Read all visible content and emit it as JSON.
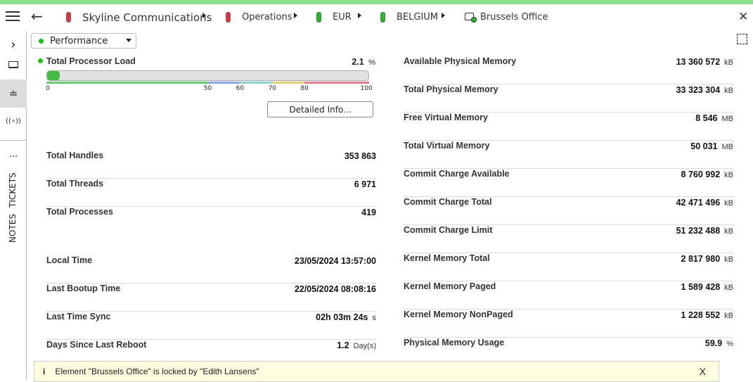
{
  "breadcrumb": [
    {
      "label": "Skyline Communications",
      "status_color": "#e0323c"
    },
    {
      "label": "Operations",
      "status_color": "#e0323c"
    },
    {
      "label": "EUR",
      "status_color": "#22bb22"
    },
    {
      "label": "BELGIUM",
      "status_color": "#22bb22"
    },
    {
      "label": "Brussels Office",
      "icon": "element-icon"
    }
  ],
  "sidebar": {
    "tickets": "TICKETS",
    "notes": "NOTES",
    "more": "···"
  },
  "page_selector": {
    "value": "Performance"
  },
  "processor": {
    "label": "Total Processor Load",
    "value": "2.1",
    "unit": "%",
    "percent": 2.1,
    "ticks": [
      "0",
      "50",
      "60",
      "70",
      "80",
      "100"
    ],
    "zone_colors": [
      "#6cc86c",
      "#8aa8e0",
      "#8ed2d2",
      "#e6cf7a",
      "#e08088"
    ]
  },
  "detailed_info": "Detailed Info...",
  "left_group1": [
    {
      "label": "Total Handles",
      "value": "353 863",
      "unit": ""
    },
    {
      "label": "Total Threads",
      "value": "6 971",
      "unit": ""
    },
    {
      "label": "Total Processes",
      "value": "419",
      "unit": ""
    }
  ],
  "left_group2": [
    {
      "label": "Local Time",
      "value": "23/05/2024 13:57:00",
      "unit": ""
    },
    {
      "label": "Last Bootup Time",
      "value": "22/05/2024 08:08:16",
      "unit": ""
    },
    {
      "label": "Last Time Sync",
      "value": "02h 03m 24s",
      "unit": "s"
    },
    {
      "label": "Days Since Last Reboot",
      "value": "1.2",
      "unit": "Day(s)"
    }
  ],
  "right": [
    {
      "label": "Available Physical Memory",
      "value": "13 360 572",
      "unit": "kB"
    },
    {
      "label": "Total Physical Memory",
      "value": "33 323 304",
      "unit": "kB"
    },
    {
      "label": "Free Virtual Memory",
      "value": "8 546",
      "unit": "MB"
    },
    {
      "label": "Total Virtual Memory",
      "value": "50 031",
      "unit": "MB"
    },
    {
      "label": "Commit Charge Available",
      "value": "8 760 992",
      "unit": "kB"
    },
    {
      "label": "Commit Charge Total",
      "value": "42 471 496",
      "unit": "kB"
    },
    {
      "label": "Commit Charge Limit",
      "value": "51 232 488",
      "unit": "kB"
    },
    {
      "label": "Kernel Memory Total",
      "value": "2 817 980",
      "unit": "kB"
    },
    {
      "label": "Kernel Memory Paged",
      "value": "1 589 428",
      "unit": "kB"
    },
    {
      "label": "Kernel Memory NonPaged",
      "value": "1 228 552",
      "unit": "kB"
    },
    {
      "label": "Physical Memory Usage",
      "value": "59.9",
      "unit": "%"
    }
  ],
  "banner": {
    "icon": "i",
    "text": "Element \"Brussels Office\" is locked by \"Edith Lansens\"",
    "close": "X"
  }
}
